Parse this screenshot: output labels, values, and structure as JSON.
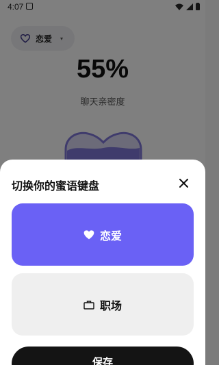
{
  "status_bar": {
    "time": "4:07",
    "icons": [
      "app-notification-icon",
      "wifi-icon",
      "signal-icon",
      "battery-icon"
    ]
  },
  "mode_chip": {
    "label": "恋爱",
    "icon": "heart-outline-icon",
    "caret": "▾"
  },
  "intimacy": {
    "value": "55%",
    "label": "聊天亲密度"
  },
  "sheet": {
    "title": "切换你的蜜语键盘",
    "options": [
      {
        "label": "恋爱",
        "icon": "heart-icon",
        "selected": true
      },
      {
        "label": "职场",
        "icon": "briefcase-icon",
        "selected": false
      }
    ],
    "save_label": "保存"
  },
  "colors": {
    "accent": "#6a61f5",
    "option_inactive": "#efefef",
    "save_button": "#141414"
  }
}
